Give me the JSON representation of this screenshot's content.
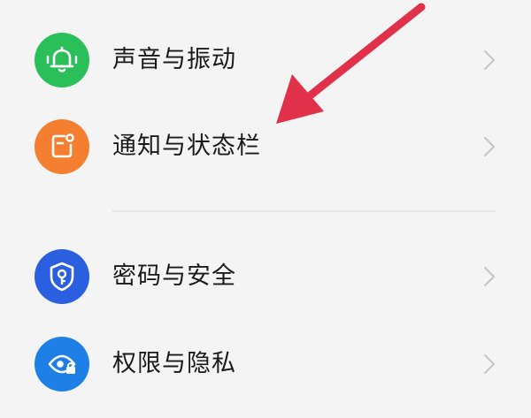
{
  "settings": {
    "items": [
      {
        "label": "声音与振动",
        "icon": "bell-icon",
        "color": "#2bbf5a"
      },
      {
        "label": "通知与状态栏",
        "icon": "notification-badge-icon",
        "color": "#f47f30"
      },
      {
        "label": "密码与安全",
        "icon": "shield-key-icon",
        "color": "#2a5fe0"
      },
      {
        "label": "权限与隐私",
        "icon": "eye-lock-icon",
        "color": "#1e7fe6"
      }
    ]
  },
  "annotation": {
    "arrow_color": "#e0304a"
  }
}
